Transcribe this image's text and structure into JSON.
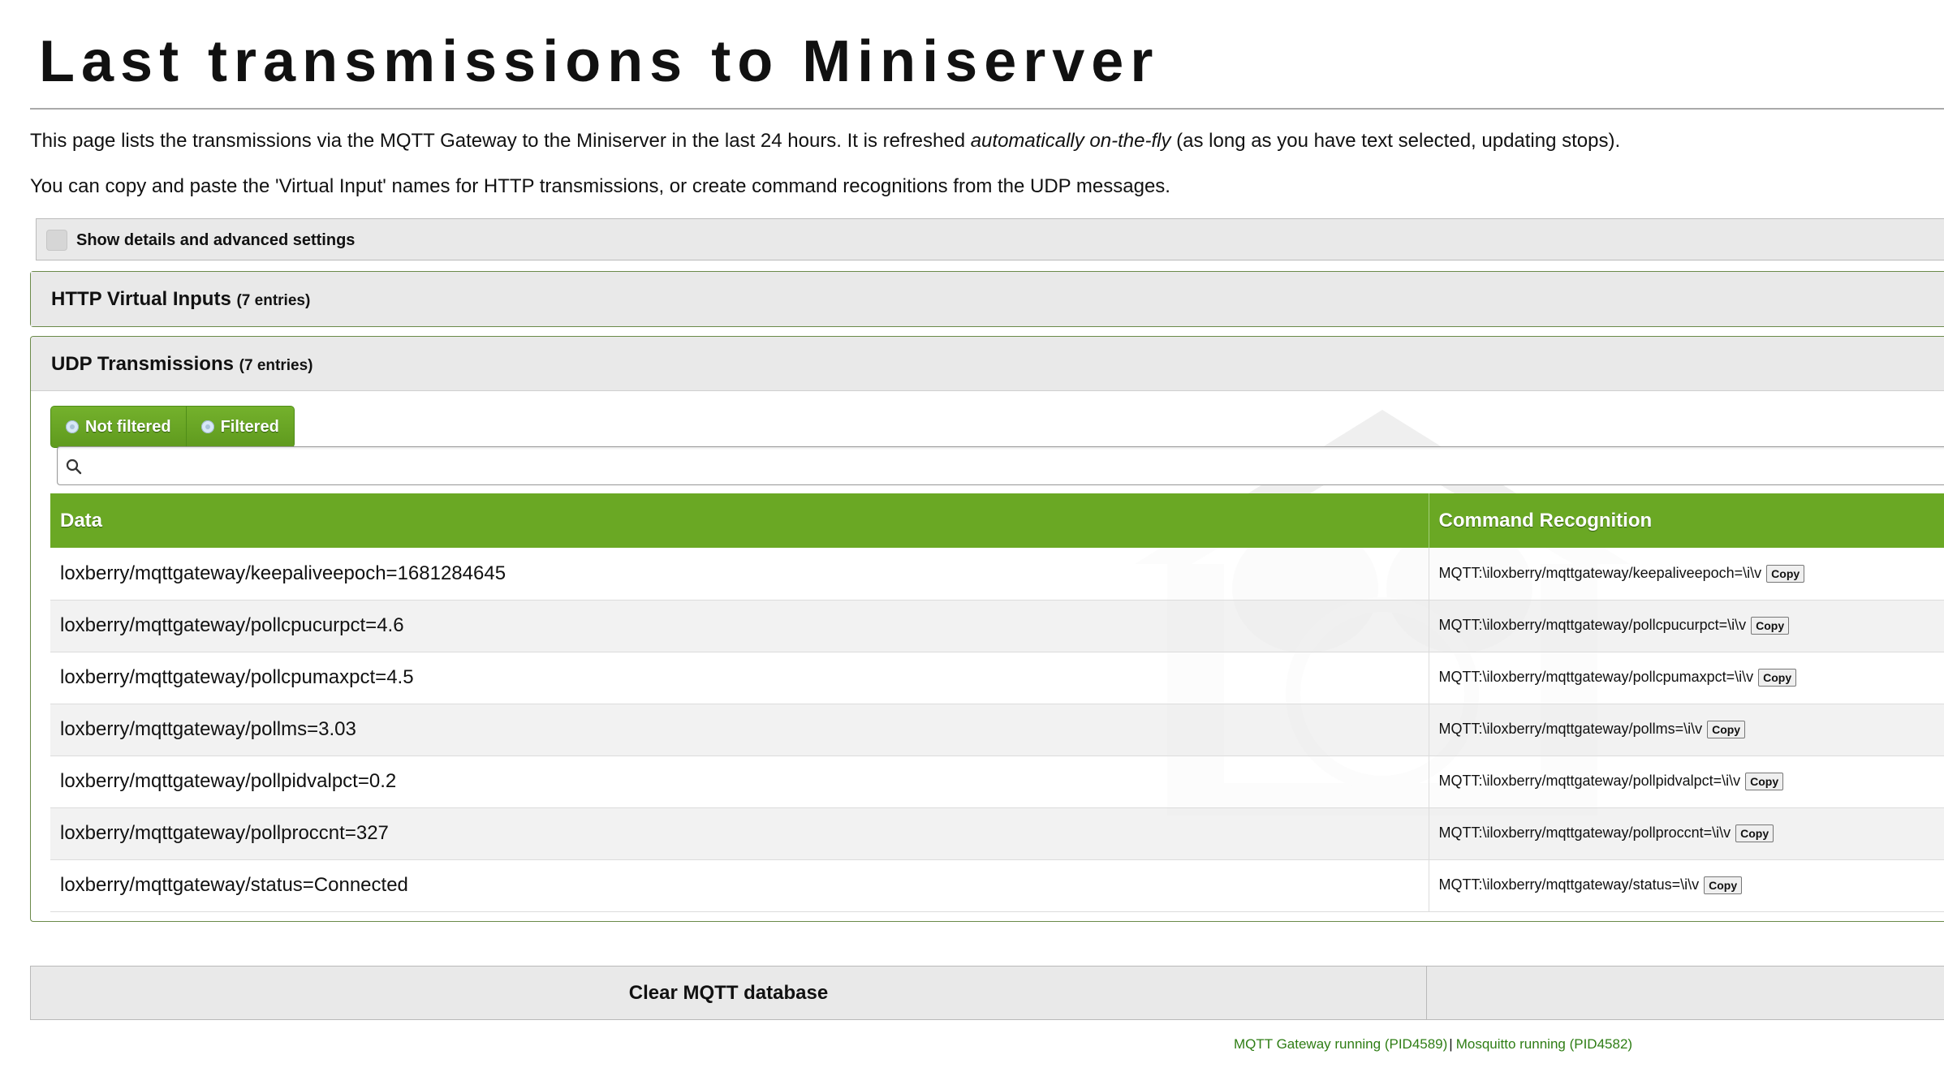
{
  "page": {
    "title": "Last transmissions to Miniserver",
    "intro1": {
      "before": "This page lists the transmissions via the MQTT Gateway to the Miniserver in the last 24 hours. It is refreshed ",
      "em": "automatically on-the-fly",
      "after": " (as long as you have text selected, updating stops)."
    },
    "intro2": "You can copy and paste the 'Virtual Input' names for HTTP transmissions, or create command recognitions from the UDP messages."
  },
  "details": {
    "label": "Show details and advanced settings",
    "checked": false
  },
  "http": {
    "title": "HTTP Virtual Inputs",
    "count": "(7 entries)"
  },
  "udp": {
    "title": "UDP Transmissions",
    "count": "(7 entries)",
    "filters": {
      "not_filtered": "Not filtered",
      "filtered": "Filtered"
    },
    "search": {
      "value": "",
      "placeholder": ""
    },
    "columns": {
      "data": "Data",
      "command": "Command Recognition"
    },
    "copy_label": "Copy",
    "rows": [
      {
        "data": "loxberry/mqttgateway/keepaliveepoch=1681284645",
        "cmd": "MQTT:\\iloxberry/mqttgateway/keepaliveepoch=\\i\\v"
      },
      {
        "data": "loxberry/mqttgateway/pollcpucurpct=4.6",
        "cmd": "MQTT:\\iloxberry/mqttgateway/pollcpucurpct=\\i\\v"
      },
      {
        "data": "loxberry/mqttgateway/pollcpumaxpct=4.5",
        "cmd": "MQTT:\\iloxberry/mqttgateway/pollcpumaxpct=\\i\\v"
      },
      {
        "data": "loxberry/mqttgateway/pollms=3.03",
        "cmd": "MQTT:\\iloxberry/mqttgateway/pollms=\\i\\v"
      },
      {
        "data": "loxberry/mqttgateway/pollpidvalpct=0.2",
        "cmd": "MQTT:\\iloxberry/mqttgateway/pollpidvalpct=\\i\\v"
      },
      {
        "data": "loxberry/mqttgateway/pollproccnt=327",
        "cmd": "MQTT:\\iloxberry/mqttgateway/pollproccnt=\\i\\v"
      },
      {
        "data": "loxberry/mqttgateway/status=Connected",
        "cmd": "MQTT:\\iloxberry/mqttgateway/status=\\i\\v"
      }
    ]
  },
  "footer": {
    "clear_button": "Clear MQTT database",
    "gateway_status": "MQTT Gateway running (PID4589)",
    "separator": "|",
    "mosquitto_status": "Mosquitto running (PID4582)"
  },
  "colors": {
    "accent_green": "#6aa824",
    "status_green": "#2e7d14",
    "panel_grey": "#e9e9e9"
  }
}
